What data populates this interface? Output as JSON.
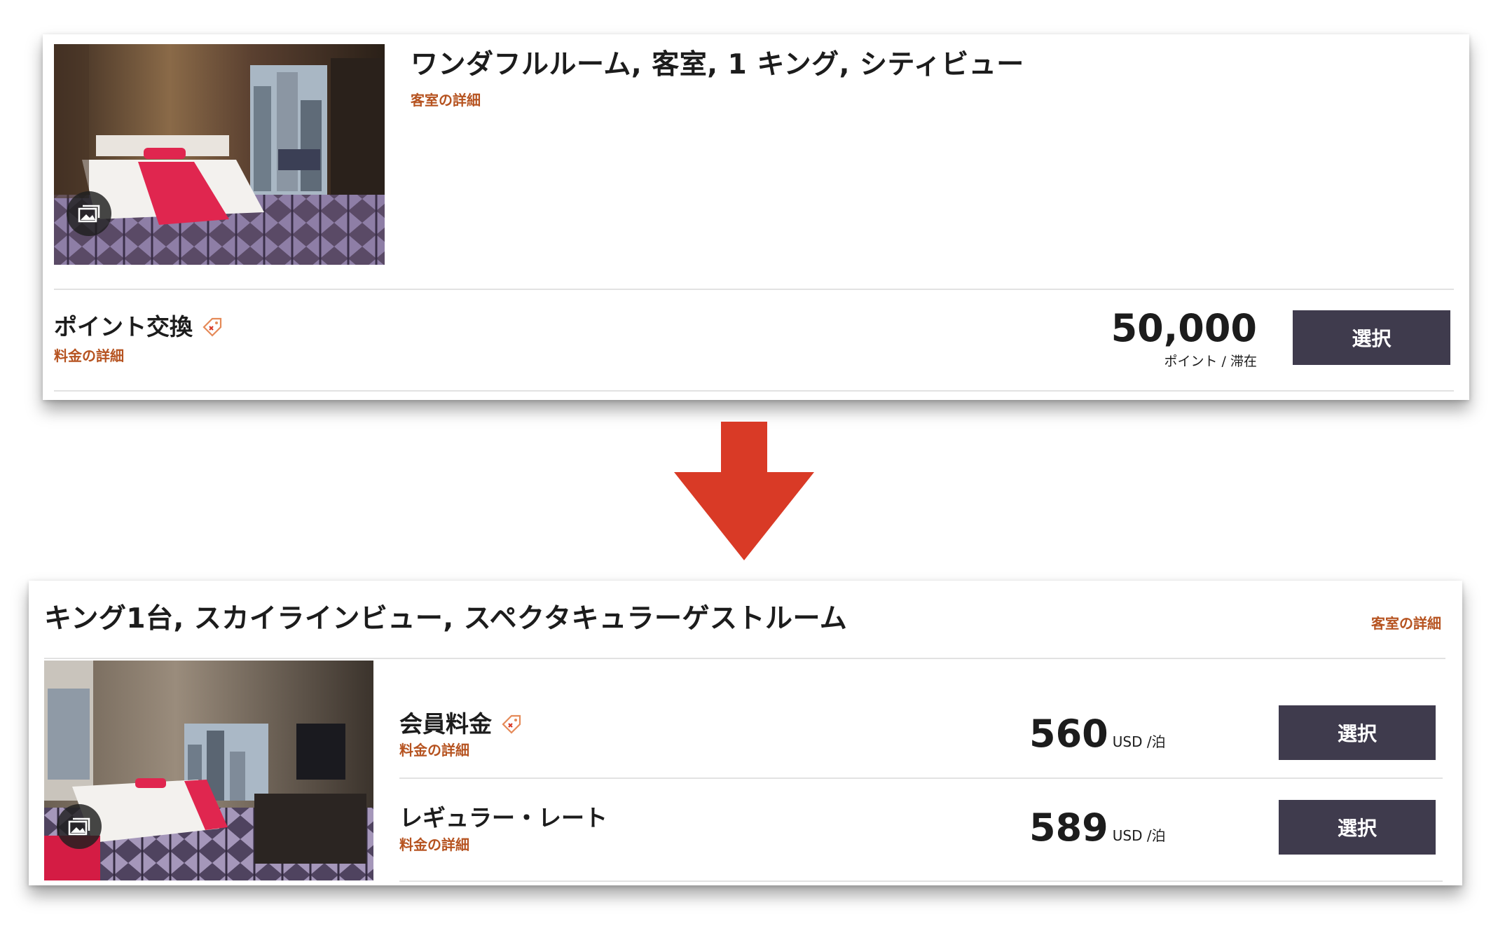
{
  "colors": {
    "accent_link": "#b65320",
    "button_bg": "#3f3b4d",
    "arrow": "#d93a26",
    "divider": "#e2e2e2"
  },
  "before": {
    "room_title": "ワンダフルルーム, 客室, 1 キング, シティビュー",
    "room_details_link": "客室の詳細",
    "gallery_icon": "gallery-icon",
    "rate": {
      "name": "ポイント交換",
      "tag_icon": "member-rate-tag-icon",
      "details_link": "料金の詳細",
      "price": "50,000",
      "unit": "ポイント / 滞在",
      "select_label": "選択"
    }
  },
  "arrow_icon": "down-arrow-icon",
  "after": {
    "room_title": "キング1台, スカイラインビュー, スペクタキュラーゲストルーム",
    "room_details_link": "客室の詳細",
    "gallery_icon": "gallery-icon",
    "rates": [
      {
        "name": "会員料金",
        "tag_icon": "member-rate-tag-icon",
        "details_link": "料金の詳細",
        "price": "560",
        "unit": "USD /泊",
        "select_label": "選択"
      },
      {
        "name": "レギュラー・レート",
        "details_link": "料金の詳細",
        "price": "589",
        "unit": "USD /泊",
        "select_label": "選択"
      }
    ]
  }
}
